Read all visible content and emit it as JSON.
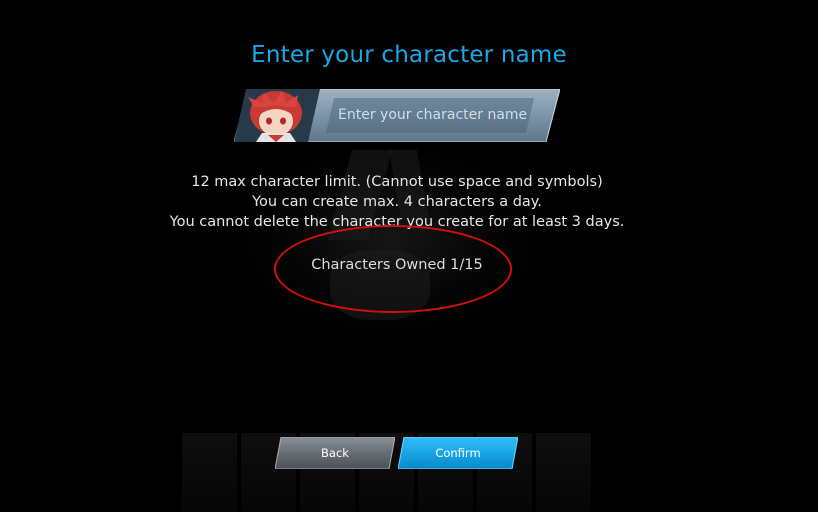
{
  "dialog": {
    "title": "Enter your character name",
    "name_input": {
      "value": "",
      "placeholder": "Enter your character name"
    },
    "info_lines": [
      "12 max character limit. (Cannot use space and symbols)",
      "You can create max. 4 characters a day.",
      "You cannot delete the character you create for at least 3 days."
    ],
    "characters_owned": "Characters Owned 1/15",
    "buttons": {
      "back": "Back",
      "confirm": "Confirm"
    }
  },
  "colors": {
    "title": "#1ba8e6",
    "confirm_button": "#18a6e8",
    "back_button": "#6c7278",
    "highlight_ring": "#d40d0d",
    "banner": "#7f98ab"
  }
}
